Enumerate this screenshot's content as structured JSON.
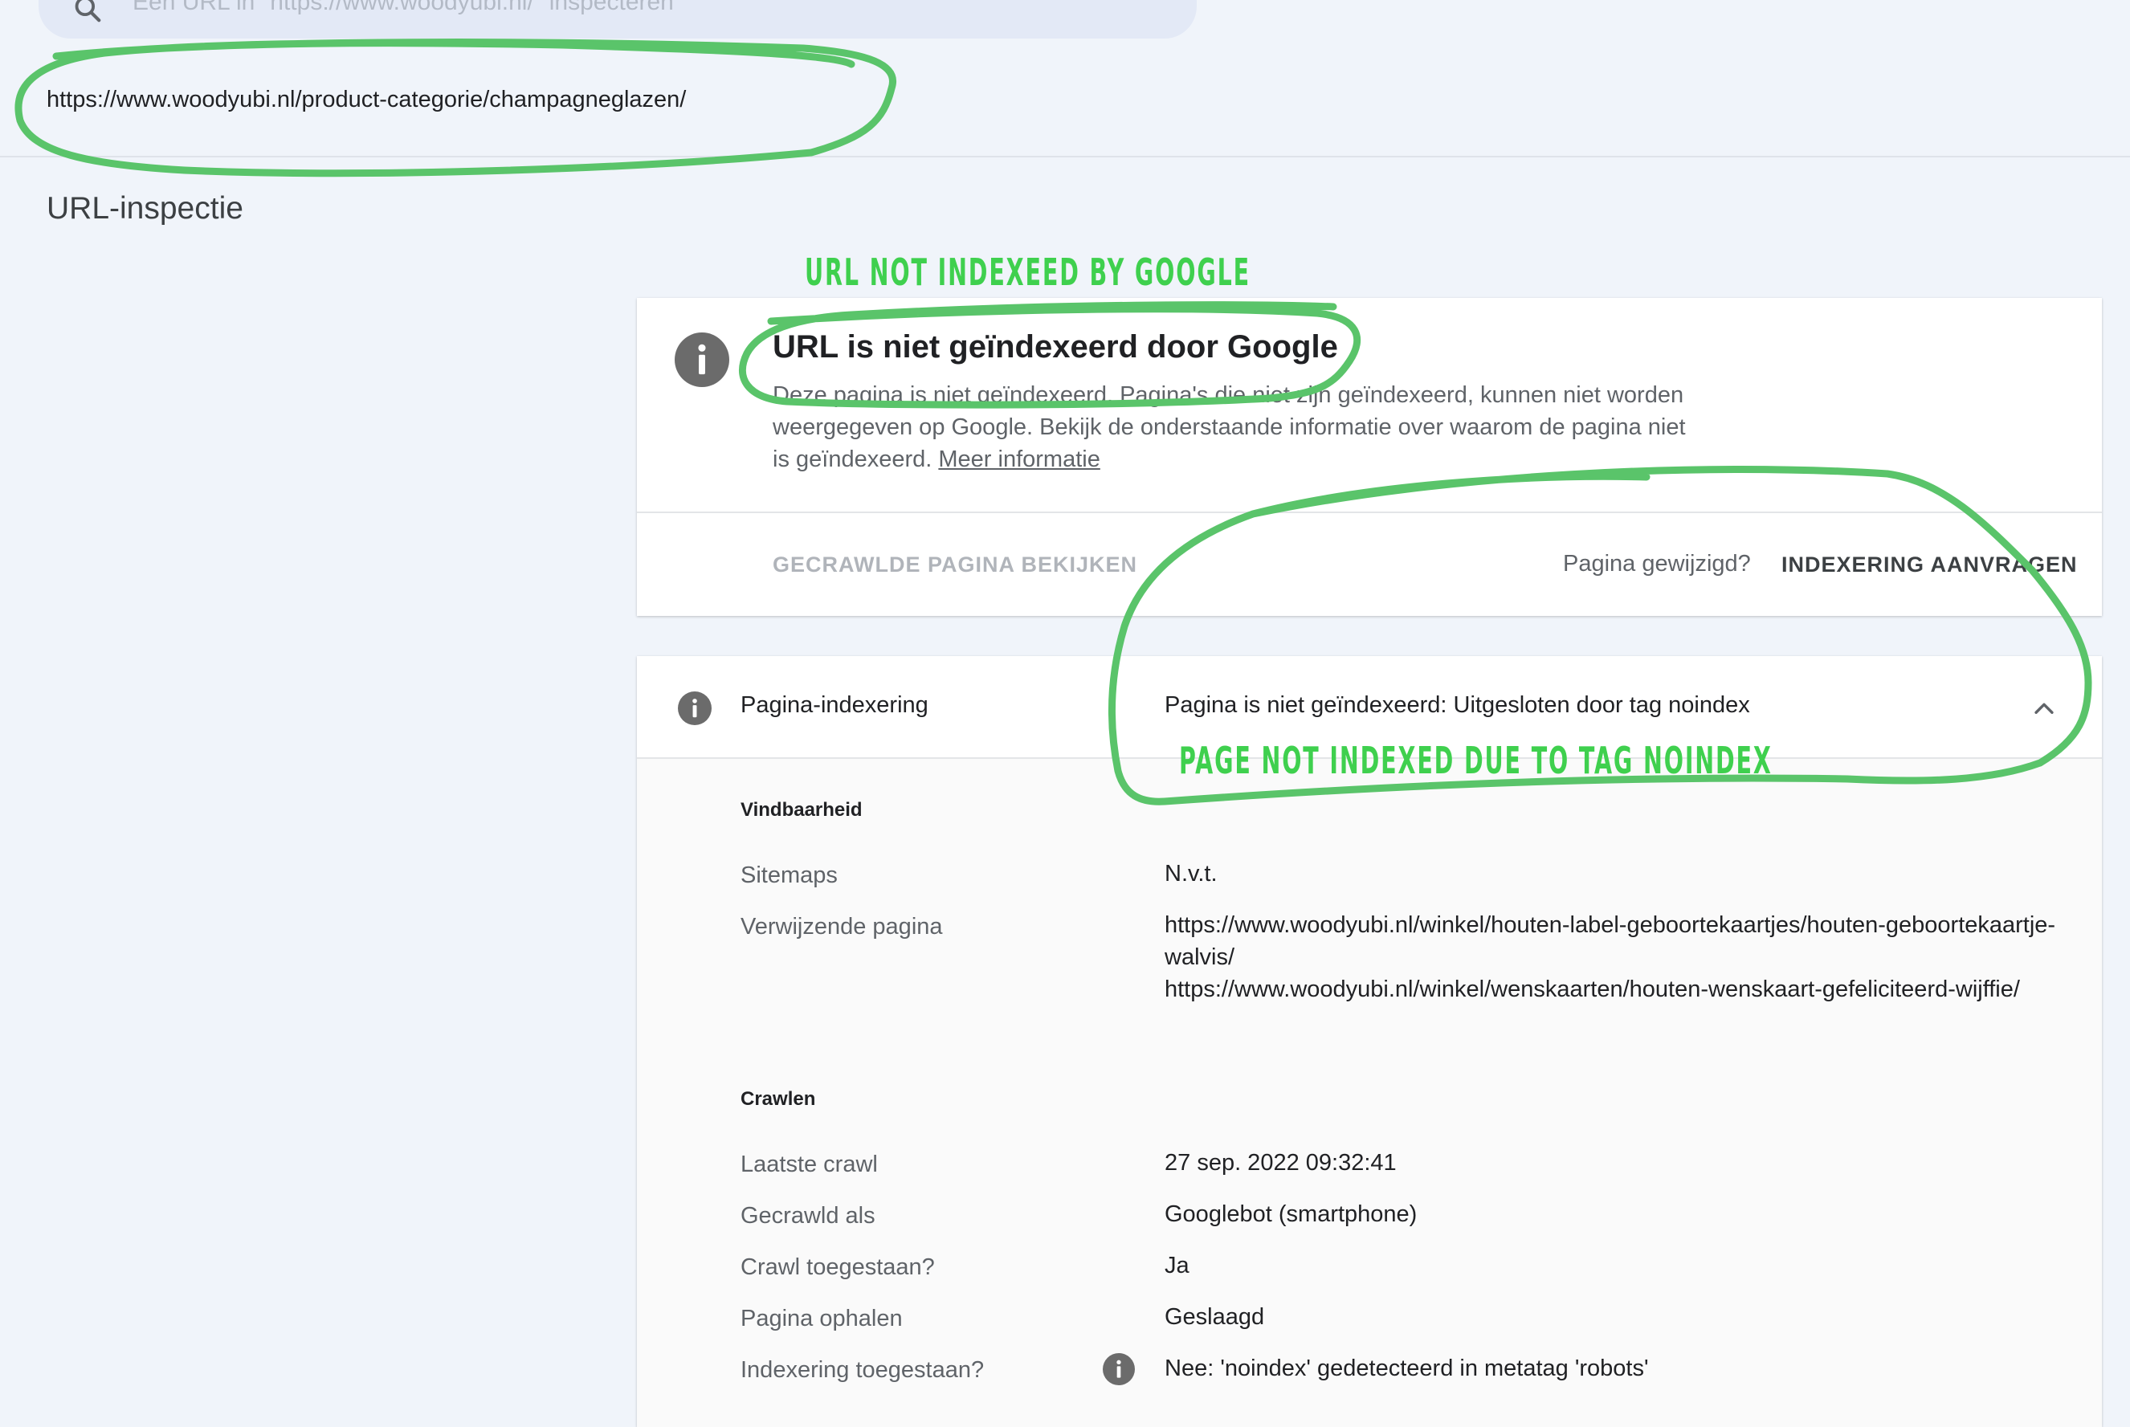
{
  "search": {
    "placeholder": "Een URL in \"https://www.woodyubi.nl/\" inspecteren"
  },
  "inspected_url": "https://www.woodyubi.nl/product-categorie/champagneglazen/",
  "page_title": "URL-inspectie",
  "status_card": {
    "title": "URL is niet geïndexeerd door Google",
    "description": "Deze pagina is niet geïndexeerd. Pagina's die niet zijn geïndexeerd, kunnen niet worden weergegeven op Google. Bekijk de onderstaande informatie over waarom de pagina niet is geïndexeerd.",
    "learn_more": "Meer informatie",
    "view_crawled_label": "GECRAWLDE PAGINA BEKIJKEN",
    "page_changed": "Pagina gewijzigd?",
    "request_indexing_label": "INDEXERING AANVRAGEN"
  },
  "indexing": {
    "label": "Pagina-indexering",
    "status": "Pagina is niet geïndexeerd: Uitgesloten door tag noindex",
    "discovery": {
      "section_title": "Vindbaarheid",
      "sitemaps_label": "Sitemaps",
      "sitemaps_value": "N.v.t.",
      "referring_label": "Verwijzende pagina",
      "referring_values": [
        "https://www.woodyubi.nl/winkel/houten-label-geboortekaartjes/houten-geboortekaartje-walvis/",
        "https://www.woodyubi.nl/winkel/wenskaarten/houten-wenskaart-gefeliciteerd-wijffie/"
      ]
    },
    "crawl": {
      "section_title": "Crawlen",
      "rows": [
        {
          "label": "Laatste crawl",
          "value": "27 sep. 2022 09:32:41"
        },
        {
          "label": "Gecrawld als",
          "value": "Googlebot (smartphone)"
        },
        {
          "label": "Crawl toegestaan?",
          "value": "Ja"
        },
        {
          "label": "Pagina ophalen",
          "value": "Geslaagd"
        },
        {
          "label": "Indexering toegestaan?",
          "value": "Nee: 'noindex' gedetecteerd in metatag 'robots'"
        }
      ]
    }
  },
  "annotations": {
    "top": "URL NOT INDEXEED BY GOOGLE",
    "bottom": "PAGE NOT INDEXED DUE TO TAG NOINDEX",
    "color": "#3fd04e"
  },
  "colors": {
    "background": "#f0f4fa",
    "card": "#ffffff",
    "info_icon": "#6b6b6b",
    "annotation": "#5ac46a"
  }
}
